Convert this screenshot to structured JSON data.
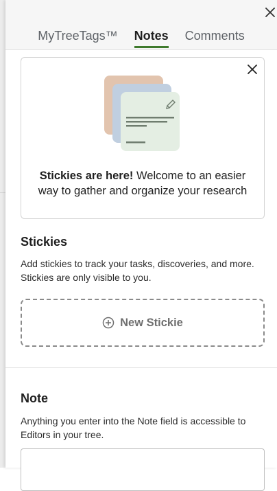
{
  "tabs": [
    {
      "label": "MyTreeTags™",
      "active": false
    },
    {
      "label": "Notes",
      "active": true
    },
    {
      "label": "Comments",
      "active": false
    }
  ],
  "promo": {
    "bold_text": "Stickies are here!",
    "text": " Welcome to an easier way to gather and organize your research"
  },
  "stickies": {
    "title": "Stickies",
    "description": "Add stickies to track your tasks, discoveries, and more. Stickies are only visible to you.",
    "new_button_label": "New Stickie"
  },
  "note": {
    "title": "Note",
    "description": "Anything you enter into the Note field is accessible to Editors in your tree.",
    "value": ""
  },
  "colors": {
    "accent": "#3f7a2d",
    "sticky_back": "#e2c4ae",
    "sticky_mid": "#c0cfe0",
    "sticky_front": "#e4eee3",
    "sticky_lines": "#6f7d6f"
  },
  "icons": {
    "panel_close": "close-icon",
    "promo_close": "close-icon",
    "new_stickie": "plus-circle-icon",
    "edit": "pencil-icon"
  }
}
